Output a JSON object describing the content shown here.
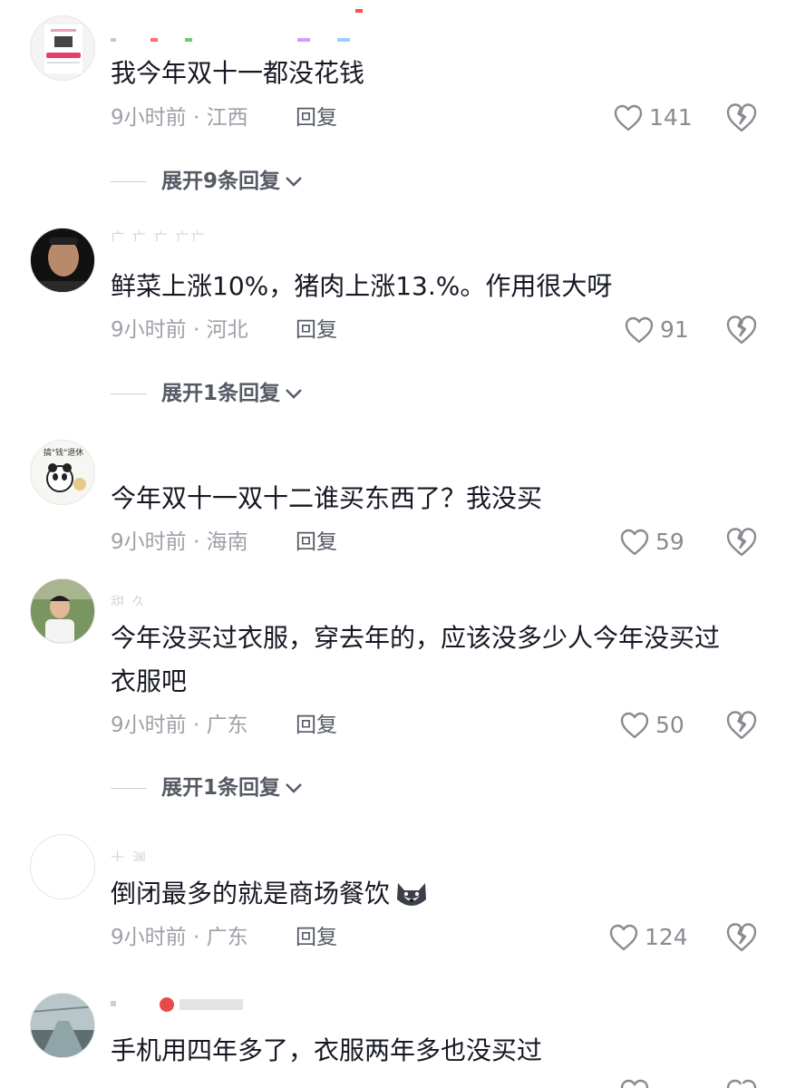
{
  "comments": [
    {
      "text": "我今年双十一都没花钱",
      "time": "9小时前 · 江西",
      "reply": "回复",
      "likes": "141",
      "expand": "展开9条回复"
    },
    {
      "text": "鲜菜上涨10%，猪肉上涨13.%。作用很大呀",
      "time": "9小时前 · 河北",
      "reply": "回复",
      "likes": "91",
      "expand": "展开1条回复"
    },
    {
      "text": "今年双十一双十二谁买东西了？我没买",
      "time": "9小时前 · 海南",
      "reply": "回复",
      "likes": "59"
    },
    {
      "text_line1": "今年没买过衣服，穿去年的，应该没多少人今年没买过",
      "text_line2": "衣服吧",
      "time": "9小时前 · 广东",
      "reply": "回复",
      "likes": "50",
      "expand": "展开1条回复"
    },
    {
      "text": "倒闭最多的就是商场餐饮",
      "time": "9小时前 · 广东",
      "reply": "回复",
      "likes": "124"
    },
    {
      "text": "手机用四年多了，衣服两年多也没买过"
    }
  ]
}
